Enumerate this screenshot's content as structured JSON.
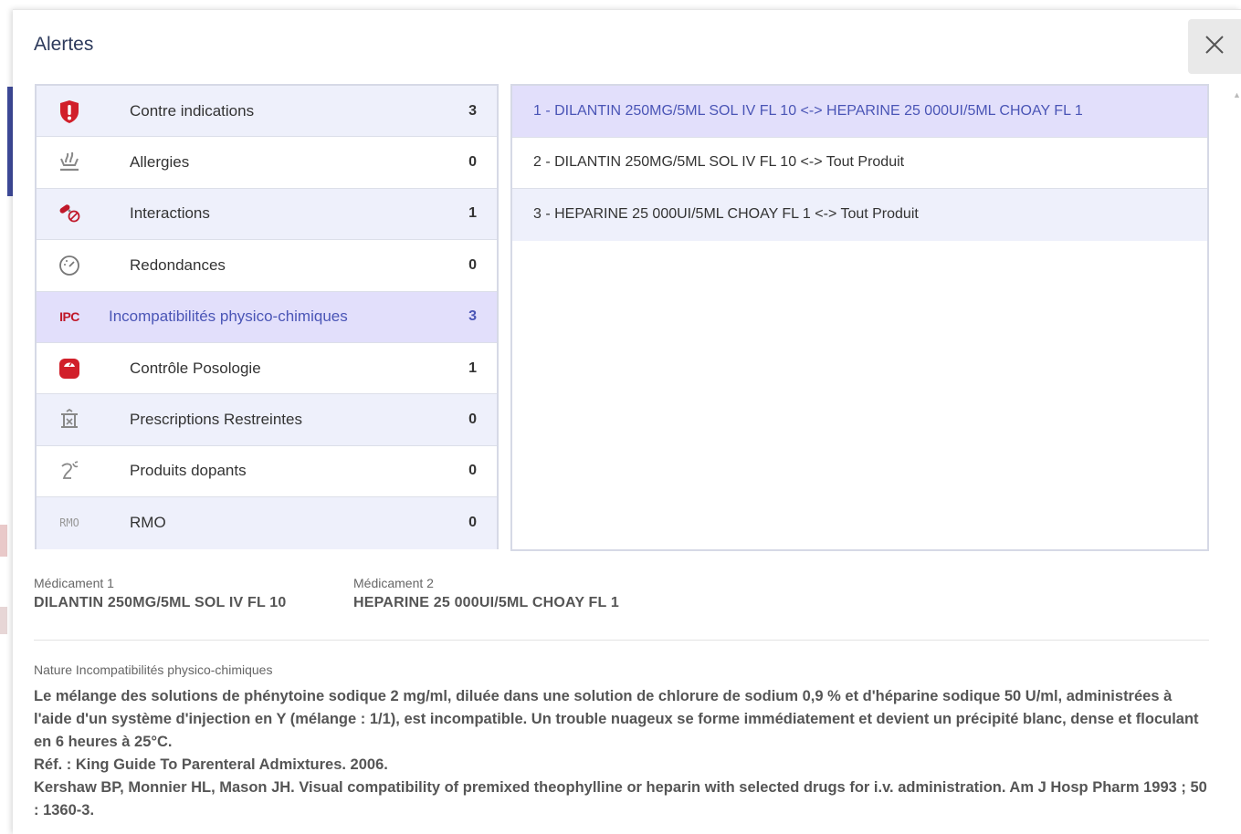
{
  "modal": {
    "title": "Alertes",
    "close_label": "×"
  },
  "categories": [
    {
      "label": "Contre indications",
      "count": "3",
      "icon": "exclamation-shield-icon"
    },
    {
      "label": "Allergies",
      "count": "0",
      "icon": "allergy-icon"
    },
    {
      "label": "Interactions",
      "count": "1",
      "icon": "interaction-pills-icon"
    },
    {
      "label": "Redondances",
      "count": "0",
      "icon": "gauge-icon"
    },
    {
      "label": "Incompatibilités physico-chimiques",
      "count": "3",
      "icon": "ipc-icon",
      "icon_text": "IPC"
    },
    {
      "label": "Contrôle Posologie",
      "count": "1",
      "icon": "scale-icon"
    },
    {
      "label": "Prescriptions Restreintes",
      "count": "0",
      "icon": "restricted-icon"
    },
    {
      "label": "Produits dopants",
      "count": "0",
      "icon": "runner-icon"
    },
    {
      "label": "RMO",
      "count": "0",
      "icon": "rmo-icon",
      "icon_text": "RMO"
    }
  ],
  "alerts": [
    "1 - DILANTIN 250MG/5ML SOL IV FL 10 <-> HEPARINE 25 000UI/5ML CHOAY FL 1",
    "2 - DILANTIN 250MG/5ML SOL IV FL 10 <-> Tout Produit",
    "3 - HEPARINE 25 000UI/5ML CHOAY FL 1 <-> Tout Produit"
  ],
  "drug1": {
    "label": "Médicament 1",
    "value": "DILANTIN 250MG/5ML SOL IV FL 10"
  },
  "drug2": {
    "label": "Médicament 2",
    "value": "HEPARINE 25 000UI/5ML CHOAY FL 1"
  },
  "nature": {
    "label": "Nature Incompatibilités physico-chimiques",
    "paragraph1": "Le mélange des solutions de phénytoine sodique 2 mg/ml, diluée dans une solution de chlorure de sodium 0,9 % et d'héparine sodique 50 U/ml, administrées à l'aide d'un système d'injection en Y (mélange : 1/1), est incompatible. Un trouble nuageux se forme immédiatement et devient un précipité blanc, dense et floculant en 6 heures à 25°C.",
    "paragraph2": "Réf. : King Guide To Parenteral Admixtures. 2006.",
    "paragraph3": "Kershaw BP, Monnier HL, Mason JH. Visual compatibility of premixed theophylline or heparin with selected drugs for i.v. administration. Am J Hosp Pharm 1993 ; 50 : 1360-3."
  },
  "colors": {
    "accent": "#4a55b6",
    "selected_row": "#e2dffb",
    "alt_row": "#eef0fb",
    "danger": "#d11f2a"
  }
}
